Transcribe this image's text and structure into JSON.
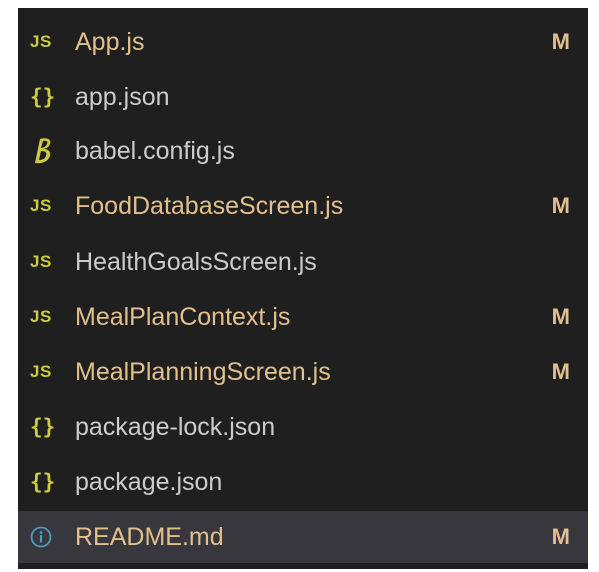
{
  "colors": {
    "panel_background": "#1f1f1f",
    "selected_row": "#37373d",
    "modified_text": "#e2c08d",
    "normal_text": "#cccccc",
    "js_icon": "#cbcb41",
    "json_icon": "#cbcb41",
    "info_icon": "#519aba"
  },
  "files": [
    {
      "name": "App.js",
      "icon": "js-icon",
      "icon_text": "JS",
      "status": "M"
    },
    {
      "name": "app.json",
      "icon": "json-icon",
      "icon_text": "{}",
      "status": ""
    },
    {
      "name": "babel.config.js",
      "icon": "babel-icon",
      "icon_text": "",
      "status": ""
    },
    {
      "name": "FoodDatabaseScreen.js",
      "icon": "js-icon",
      "icon_text": "JS",
      "status": "M"
    },
    {
      "name": "HealthGoalsScreen.js",
      "icon": "js-icon",
      "icon_text": "JS",
      "status": ""
    },
    {
      "name": "MealPlanContext.js",
      "icon": "js-icon",
      "icon_text": "JS",
      "status": "M"
    },
    {
      "name": "MealPlanningScreen.js",
      "icon": "js-icon",
      "icon_text": "JS",
      "status": "M"
    },
    {
      "name": "package-lock.json",
      "icon": "json-icon",
      "icon_text": "{}",
      "status": ""
    },
    {
      "name": "package.json",
      "icon": "json-icon",
      "icon_text": "{}",
      "status": ""
    },
    {
      "name": "README.md",
      "icon": "info-icon",
      "icon_text": "",
      "status": "M"
    }
  ]
}
